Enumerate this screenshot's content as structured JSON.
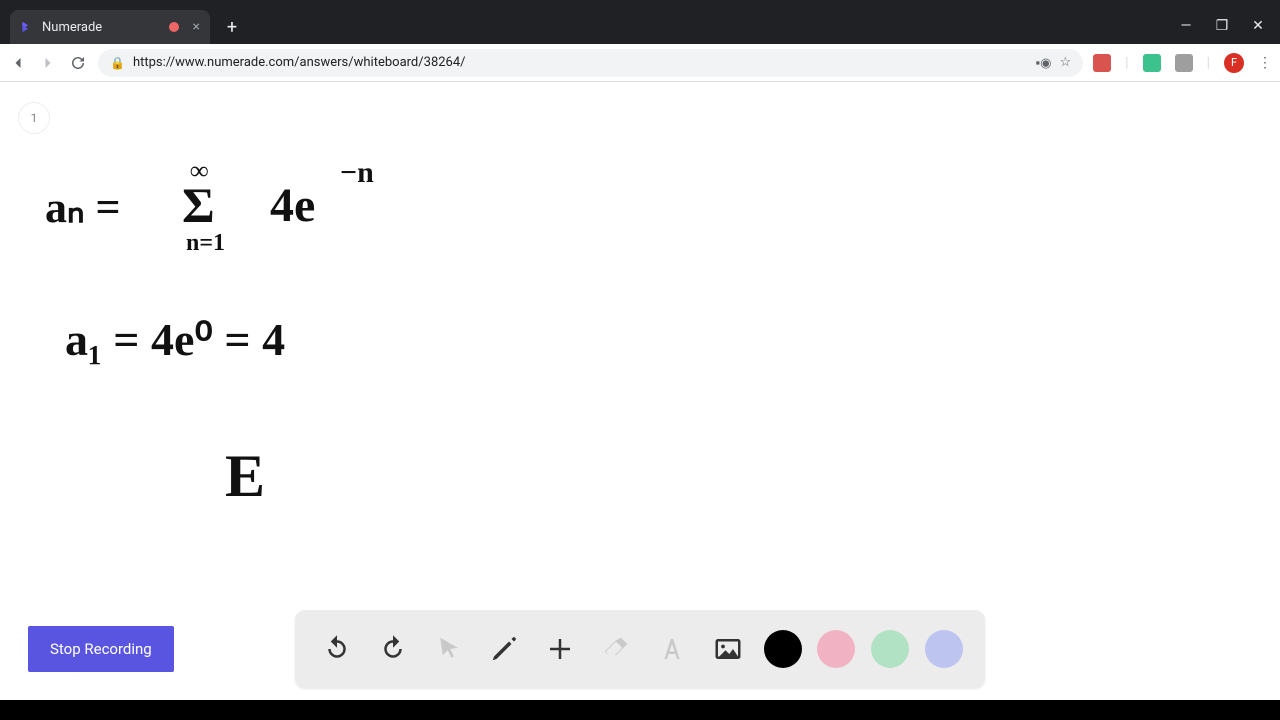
{
  "browser": {
    "tab_title": "Numerade",
    "url": "https://www.numerade.com/answers/whiteboard/38264/",
    "avatar_letter": "F"
  },
  "whiteboard": {
    "page_number": "1",
    "line1": "aₙ =",
    "line1_sum_top": "∞",
    "line1_sum_sigma": "Σ",
    "line1_sum_bottom": "n=1",
    "line1_rhs": "4e",
    "line1_exp": "−n",
    "line2": "a₁ = 4e⁰ = 4",
    "line3": "E"
  },
  "controls": {
    "stop_recording": "Stop Recording"
  },
  "toolbar": {
    "colors": {
      "black": "#000000",
      "pink": "#f1b3c3",
      "green": "#b2e2c4",
      "blue": "#bcc4ef"
    }
  }
}
